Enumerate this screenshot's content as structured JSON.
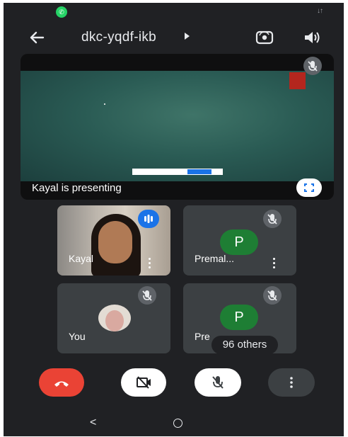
{
  "top_bar": {
    "meeting_code": "dkc-yqdf-ikb",
    "back_icon": "arrow-left-icon",
    "camera_flip_icon": "camera-flip-icon",
    "speaker_icon": "speaker-icon"
  },
  "presentation": {
    "label": "Kayal is presenting",
    "mute_icon": "mic-off-icon",
    "fullscreen_icon": "fullscreen-icon"
  },
  "participants": [
    {
      "name": "Kayal",
      "status_icon": "speaking-icon"
    },
    {
      "name": "Premal...",
      "initial": "P",
      "status_icon": "mic-off-icon"
    },
    {
      "name": "You",
      "status_icon": "mic-off-icon"
    },
    {
      "name": "Pre",
      "initial": "P",
      "status_icon": "mic-off-icon",
      "overlay": "96 others"
    }
  ],
  "controls": {
    "end_call_icon": "end-call-icon",
    "camera_icon": "camera-off-icon",
    "mic_icon": "mic-off-icon",
    "more_icon": "more-vertical-icon"
  },
  "colors": {
    "background": "#202124",
    "tile": "#3c4043",
    "end_call": "#ea4335",
    "avatar_green": "#1e7e34",
    "speaking_blue": "#1a73e8"
  }
}
